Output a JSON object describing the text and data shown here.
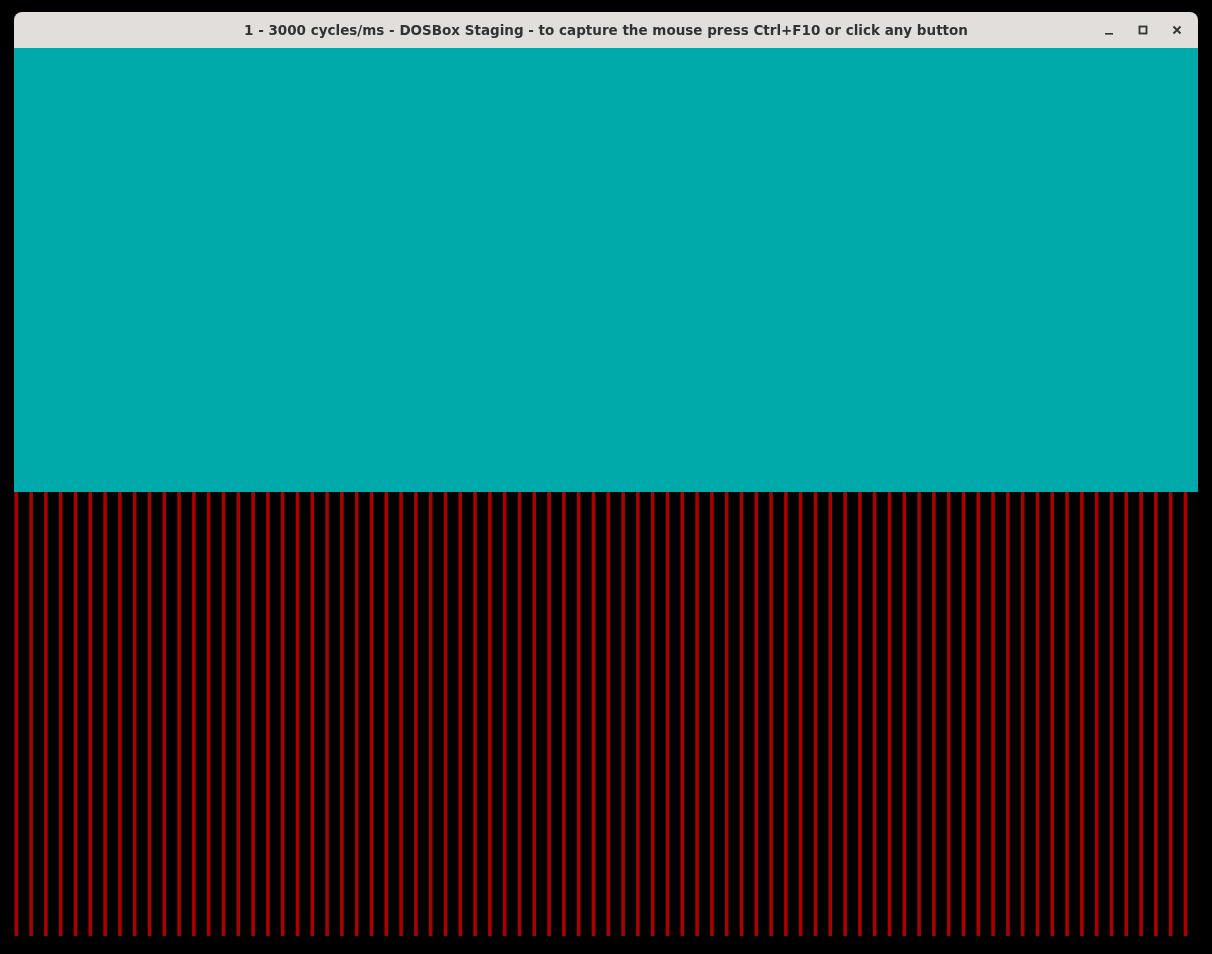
{
  "window": {
    "title": "1 - 3000 cycles/ms - DOSBox Staging - to capture the mouse press Ctrl+F10 or click any button"
  }
}
